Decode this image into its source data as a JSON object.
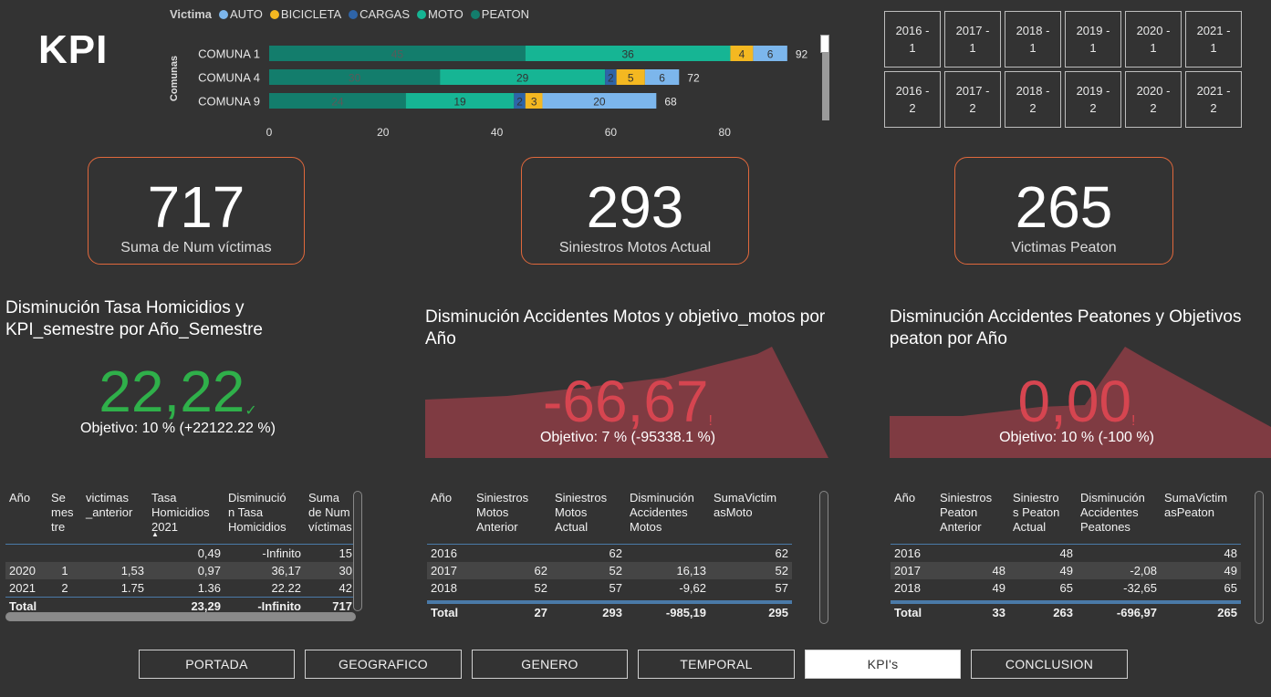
{
  "page_title": "KPI",
  "legend": {
    "title": "Victima",
    "items": [
      {
        "label": "AUTO",
        "color": "#7cb6ec"
      },
      {
        "label": "BICICLETA",
        "color": "#f4b821"
      },
      {
        "label": "CARGAS",
        "color": "#2e64a8"
      },
      {
        "label": "MOTO",
        "color": "#16b594"
      },
      {
        "label": "PEATON",
        "color": "#137d6c"
      }
    ]
  },
  "chart_data": {
    "type": "bar",
    "orientation": "horizontal",
    "stacked": true,
    "ylabel": "Comunas",
    "categories": [
      "COMUNA 1",
      "COMUNA 4",
      "COMUNA 9"
    ],
    "series": [
      {
        "name": "PEATON",
        "values": [
          45,
          30,
          24
        ],
        "color": "#137d6c"
      },
      {
        "name": "MOTO",
        "values": [
          36,
          29,
          19
        ],
        "color": "#16b594"
      },
      {
        "name": "CARGAS",
        "values": [
          0,
          2,
          2
        ],
        "color": "#2e64a8"
      },
      {
        "name": "BICICLETA",
        "values": [
          4,
          5,
          3
        ],
        "color": "#f4b821"
      },
      {
        "name": "AUTO",
        "values": [
          6,
          6,
          20
        ],
        "color": "#7cb6ec"
      }
    ],
    "totals": [
      "92",
      "72",
      "68"
    ],
    "xticks": [
      "0",
      "20",
      "40",
      "60",
      "80"
    ],
    "xlim": [
      0,
      92
    ]
  },
  "slicer": {
    "items": [
      "2016 -\n1",
      "2017 -\n1",
      "2018 -\n1",
      "2019 -\n1",
      "2020 -\n1",
      "2021 -\n1",
      "2016 -\n2",
      "2017 -\n2",
      "2018 -\n2",
      "2019 -\n2",
      "2020 -\n2",
      "2021 -\n2"
    ]
  },
  "cards": [
    {
      "value": "717",
      "label": "Suma de Num víctimas"
    },
    {
      "value": "293",
      "label": "Siniestros Motos Actual"
    },
    {
      "value": "265",
      "label": "Victimas Peaton"
    }
  ],
  "gauges": [
    {
      "title": "Disminución Tasa Homicidios y KPI_semestre por Año_Semestre",
      "value": "22,22",
      "status_icon": "✓",
      "goal": "Objetivo: 10 % (+22122.22 %)",
      "color": "#2fb04a"
    },
    {
      "title": "Disminución Accidentes Motos y objetivo_motos por Año",
      "value": "-66,67",
      "status_icon": "!",
      "goal": "Objetivo: 7 % (-95338.1 %)",
      "color": "#d64550"
    },
    {
      "title": "Disminución Accidentes Peatones y Objetivos peaton por Año",
      "value": "0,00",
      "status_icon": "!",
      "goal": "Objetivo: 10 % (-100 %)",
      "color": "#d64550"
    }
  ],
  "table1": {
    "headers": [
      "Año",
      "Se\nmes\ntre",
      "victimas\n_anterior",
      "Tasa\nHomicidios\n2021",
      "Disminució\nn Tasa\nHomicidios",
      "Suma\nde Num\nvíctimas"
    ],
    "rows": [
      [
        "",
        "",
        "",
        "0,49",
        "-Infinito",
        "15"
      ],
      [
        "2020",
        "1",
        "1,53",
        "0,97",
        "36,17",
        "30"
      ],
      [
        "2021",
        "2",
        "1.75",
        "1.36",
        "22.22",
        "42"
      ]
    ],
    "total": [
      "Total",
      "",
      "",
      "23,29",
      "-Infinito",
      "717"
    ]
  },
  "table2": {
    "headers": [
      "Año",
      "Siniestros\nMotos\nAnterior",
      "Siniestros\nMotos\nActual",
      "Disminución\nAccidentes\nMotos",
      "SumaVictim\nasMoto"
    ],
    "rows": [
      [
        "2016",
        "",
        "62",
        "",
        "62"
      ],
      [
        "2017",
        "62",
        "52",
        "16,13",
        "52"
      ],
      [
        "2018",
        "52",
        "57",
        "-9,62",
        "57"
      ]
    ],
    "total": [
      "Total",
      "27",
      "293",
      "-985,19",
      "295"
    ]
  },
  "table3": {
    "headers": [
      "Año",
      "Siniestros\nPeaton\nAnterior",
      "Siniestro\ns Peaton\nActual",
      "Disminución\nAccidentes\nPeatones",
      "SumaVictim\nasPeaton"
    ],
    "rows": [
      [
        "2016",
        "",
        "48",
        "",
        "48"
      ],
      [
        "2017",
        "48",
        "49",
        "-2,08",
        "49"
      ],
      [
        "2018",
        "49",
        "65",
        "-32,65",
        "65"
      ]
    ],
    "total": [
      "Total",
      "33",
      "263",
      "-696,97",
      "265"
    ]
  },
  "nav": {
    "items": [
      "PORTADA",
      "GEOGRAFICO",
      "GENERO",
      "TEMPORAL",
      "KPI's",
      "CONCLUSION"
    ],
    "active": "KPI's"
  }
}
